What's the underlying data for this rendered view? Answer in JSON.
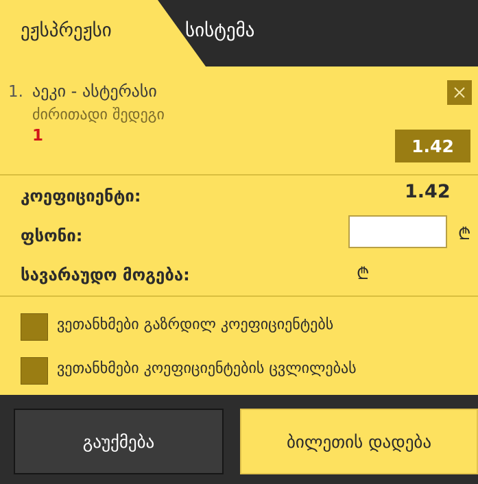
{
  "tabs": {
    "express": "ეჟსპრეჟსი",
    "system": "სისტემა"
  },
  "bet": {
    "index": "1.",
    "event": "აეკი - ასტერასი",
    "market": "ძირითადი შედეგი",
    "selection": "1",
    "odd": "1.42"
  },
  "summary": {
    "coef_label": "კოეფიციენტი:",
    "coef_value": "1.42",
    "stake_label": "ფსონი:",
    "stake_value": "",
    "currency": "₾",
    "win_label": "სავარაუდო მოგება:"
  },
  "options": [
    {
      "label": "ვეთანხმები გაზრდილ კოეფიციენტებს"
    },
    {
      "label": "ვეთანხმები კოეფიციენტების ცვლილებას"
    }
  ],
  "actions": {
    "cancel": "გაუქმება",
    "place": "ბილეთის დადება"
  },
  "colors": {
    "panel": "#fde15f",
    "accent_dark": "#9a7d13",
    "selection_red": "#d0161a",
    "background_dark": "#2d2d2d"
  },
  "icons": {
    "close": "close-icon",
    "currency": "lari-icon"
  }
}
